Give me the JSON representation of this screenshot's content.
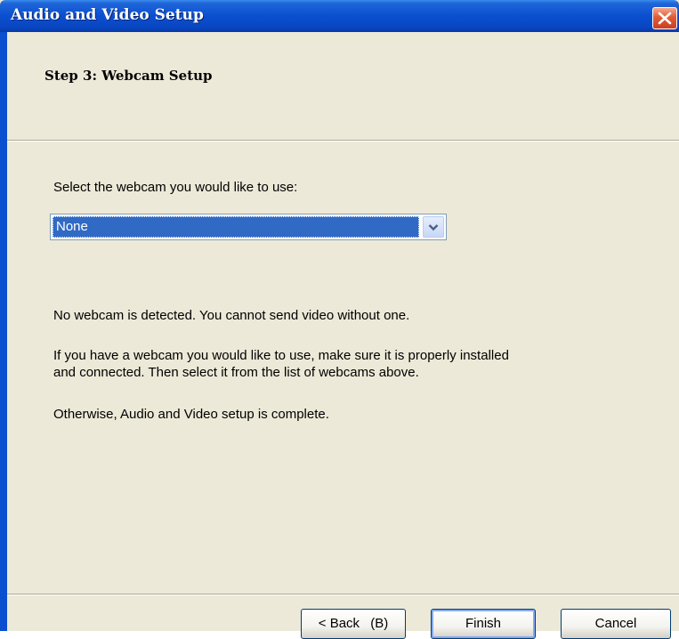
{
  "window": {
    "title": "Audio and Video Setup"
  },
  "header": {
    "step_title": "Step 3: Webcam Setup"
  },
  "webcam": {
    "label": "Select the webcam you would like to use:",
    "selected": "None"
  },
  "messages": {
    "no_webcam": "No webcam is detected. You cannot send video without one.",
    "instructions_line1": "If you have a webcam you would like to use, make sure it is properly installed",
    "instructions_line2": "and connected. Then select it from the list of webcams above.",
    "complete": "Otherwise, Audio and Video setup is complete."
  },
  "footer": {
    "back_label": "< Back",
    "back_accel": "(B)",
    "finish_label": "Finish",
    "cancel_label": "Cancel"
  },
  "colors": {
    "titlebar": "#0a4fd0",
    "dialog_bg": "#ece9d8",
    "selection": "#316ac5",
    "close": "#e35a33"
  }
}
